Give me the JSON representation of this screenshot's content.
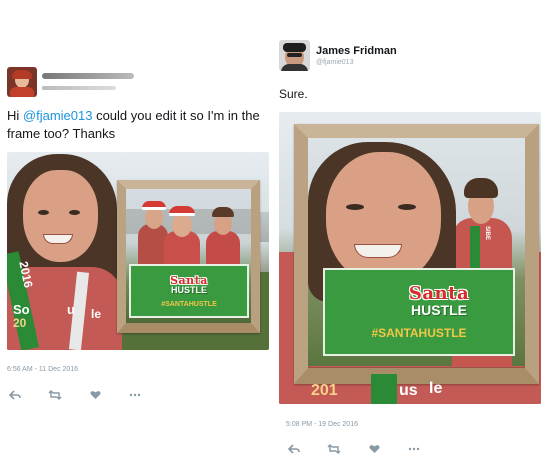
{
  "left_tweet": {
    "text_mention": "@fjamie013",
    "text_prefix": "Hi ",
    "text_suffix": " could you edit it so I'm in the frame too? Thanks",
    "timestamp": "6:56 AM - 11 Dec 2016",
    "photo": {
      "lanyard_text": "2016",
      "shirt_text_a": "So",
      "shirt_text_b": "20",
      "shirt_text_c": "u",
      "shirt_text_d": "le",
      "banner_logo_top": "Santa",
      "banner_logo_bottom": "HUSTLE",
      "banner_hashtag": "#SANTAHUSTLE"
    }
  },
  "right_tweet": {
    "user_name": "James Fridman",
    "user_handle": "@fjamie013",
    "text": "Sure.",
    "timestamp": "5:08 PM - 19 Dec 2016",
    "photo": {
      "lanyard_text": "SIBE",
      "shirt_text_a": "201",
      "shirt_text_b": "us",
      "shirt_text_c": "le",
      "banner_logo_top": "Santa",
      "banner_logo_bottom": "HUSTLE",
      "banner_hashtag": "#SANTAHUSTLE"
    }
  },
  "icons": [
    "reply-icon",
    "retweet-icon",
    "like-icon",
    "more-icon"
  ],
  "colors": {
    "mention": "#1b95e0",
    "meta": "#8899a6",
    "banner_green": "#3a9a3f",
    "frame_wood": "#c9b497"
  }
}
